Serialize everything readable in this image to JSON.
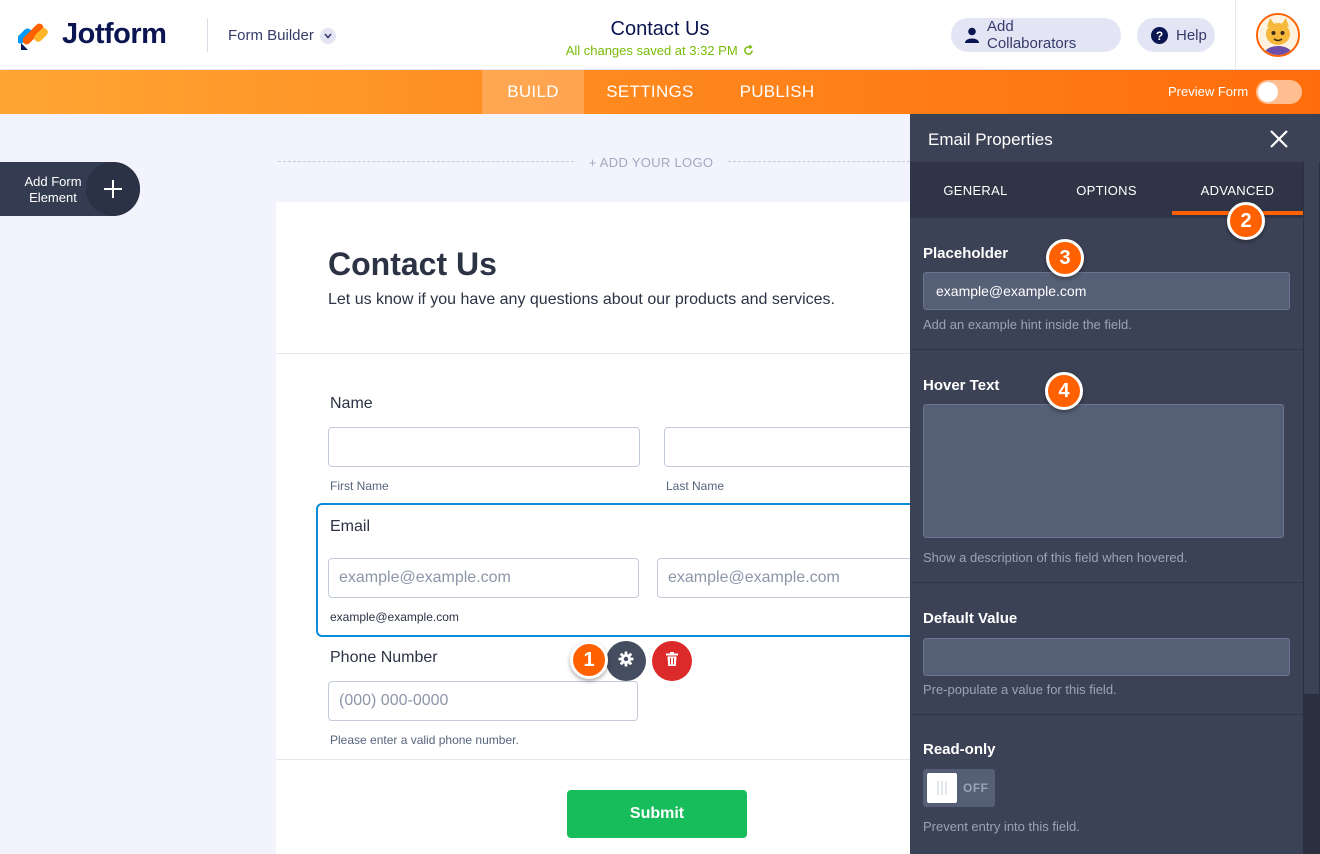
{
  "app": {
    "brand": "Jotform",
    "builder_selector": "Form Builder",
    "form_title": "Contact Us",
    "saved_status": "All changes saved at 3:32 PM",
    "add_collaborators": "Add Collaborators",
    "help": "Help"
  },
  "nav": {
    "tabs": [
      "BUILD",
      "SETTINGS",
      "PUBLISH"
    ],
    "active_tab": "BUILD",
    "preview_label": "Preview Form",
    "preview_on": false
  },
  "canvas": {
    "add_element_label": "Add Form Element",
    "add_logo": "+ ADD YOUR LOGO"
  },
  "form": {
    "heading": "Contact Us",
    "subheading": "Let us know if you have any questions about our products and services.",
    "name": {
      "label": "Name",
      "first_sublabel": "First Name",
      "last_sublabel": "Last Name"
    },
    "email": {
      "label": "Email",
      "placeholder": "example@example.com",
      "confirm_placeholder": "example@example.com",
      "sublabel": "example@example.com"
    },
    "phone": {
      "label": "Phone Number",
      "placeholder": "(000) 000-0000",
      "sublabel": "Please enter a valid phone number."
    },
    "submit": "Submit"
  },
  "panel": {
    "title": "Email Properties",
    "tabs": [
      "GENERAL",
      "OPTIONS",
      "ADVANCED"
    ],
    "active_tab": "ADVANCED",
    "placeholder": {
      "title": "Placeholder",
      "value": "example@example.com",
      "help": "Add an example hint inside the field."
    },
    "hover_text": {
      "title": "Hover Text",
      "value": "",
      "help": "Show a description of this field when hovered."
    },
    "default_value": {
      "title": "Default Value",
      "value": "",
      "help": "Pre-populate a value for this field."
    },
    "read_only": {
      "title": "Read-only",
      "state": "OFF",
      "help": "Prevent entry into this field."
    }
  },
  "badges": [
    "1",
    "2",
    "3",
    "4"
  ],
  "colors": {
    "brand_orange": "#ff6100",
    "navy": "#0a1551",
    "submit_green": "#18bd5b",
    "delete_red": "#dc2a2a",
    "focus_blue": "#0a8cda",
    "saved_green": "#78bb07"
  },
  "icons": {
    "logo": "jotform-logo-icon",
    "collaborators": "user-icon",
    "help": "question-circle-icon",
    "close": "close-icon",
    "settings": "gear-icon",
    "delete": "trash-icon",
    "add": "plus-icon",
    "saved": "refresh-icon",
    "chevron": "chevron-down-icon"
  }
}
